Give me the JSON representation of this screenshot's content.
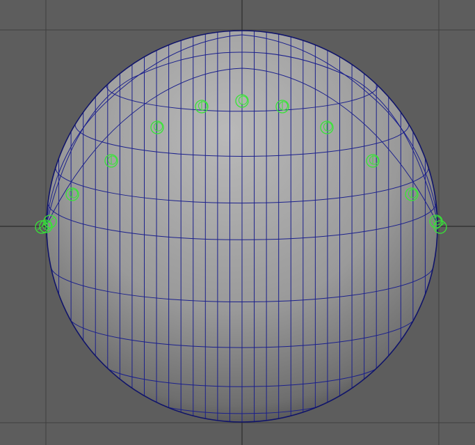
{
  "viewport": {
    "background_color": "#5d5d5d",
    "grid_color": "#3e3e3e",
    "axis_color": "#2c2c2c"
  },
  "sphere": {
    "shading_highlight": "#b9b9b9",
    "shading_mid": "#9a9a9a",
    "shading_shadow": "#3a3a3a",
    "wireframe_color": "#1a1f8c",
    "outline_color": "#10146a"
  },
  "controls": {
    "color": "#35e635",
    "icon": "circle-locator-icon",
    "count": 13
  }
}
